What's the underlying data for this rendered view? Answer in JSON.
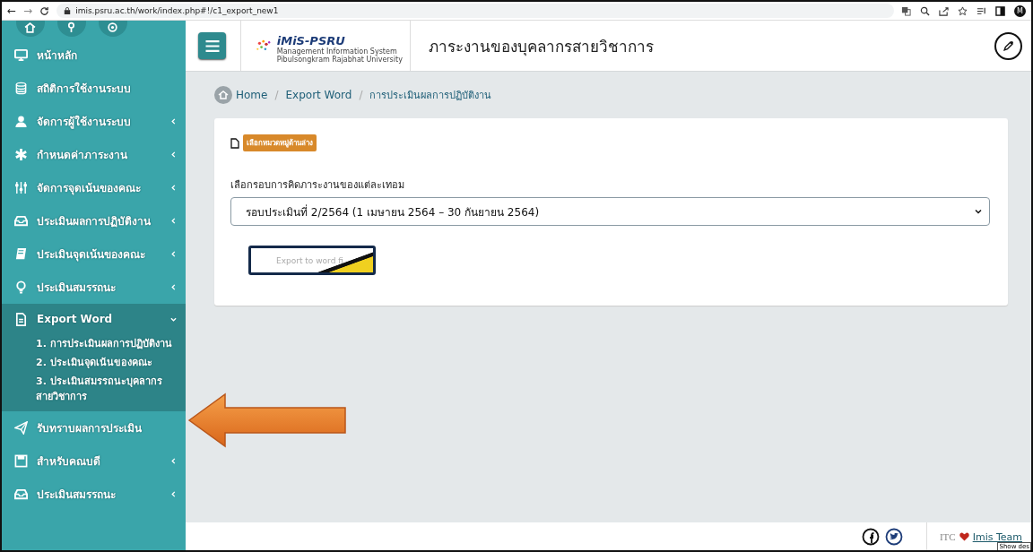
{
  "browser": {
    "back": "←",
    "forward": "→",
    "url": "imis.psru.ac.th/work/index.php#!/c1_export_new1",
    "profile": "M"
  },
  "sidebar": {
    "items": [
      {
        "label": "หน้าหลัก",
        "kind": "monitor",
        "has_caret": false,
        "expanded": false
      },
      {
        "label": "สถิติการใช้งานระบบ",
        "kind": "database",
        "has_caret": false,
        "expanded": false
      },
      {
        "label": "จัดการผู้ใช้งานระบบ",
        "kind": "user",
        "has_caret": true,
        "expanded": false
      },
      {
        "label": "กำหนดค่าภาระงาน",
        "kind": "asterisk",
        "has_caret": true,
        "expanded": false
      },
      {
        "label": "จัดการจุดเน้นของคณะ",
        "kind": "sliders",
        "has_caret": true,
        "expanded": false
      },
      {
        "label": "ประเมินผลการปฏิบัติงาน",
        "kind": "inbox",
        "has_caret": true,
        "expanded": false
      },
      {
        "label": "ประเมินจุดเน้นของคณะ",
        "kind": "book",
        "has_caret": true,
        "expanded": false
      },
      {
        "label": "ประเมินสมรรถนะ",
        "kind": "bulb",
        "has_caret": true,
        "expanded": false
      },
      {
        "label": "Export Word",
        "kind": "file",
        "has_caret": true,
        "expanded": true,
        "children": [
          {
            "label": "1. การประเมินผลการปฏิบัติงาน"
          },
          {
            "label": "2. ประเมินจุดเน้นของคณะ"
          },
          {
            "label": "3. ประเมินสมรรถนะบุคลากรสายวิชาการ"
          }
        ]
      },
      {
        "label": "รับทราบผลการประเมิน",
        "kind": "plane",
        "has_caret": false,
        "expanded": false
      },
      {
        "label": "สำหรับคณบดี",
        "kind": "save",
        "has_caret": true,
        "expanded": false
      },
      {
        "label": "ประเมินสมรรถนะ",
        "kind": "inbox",
        "has_caret": true,
        "expanded": false
      }
    ]
  },
  "header": {
    "logo": "iMiS-PSRU",
    "logo_sub": "Management Information System Pibulsongkram Rajabhat University",
    "title": "ภาระงานของบุคลากรสายวิชาการ"
  },
  "breadcrumb_separator": "/",
  "breadcrumb": [
    "Home",
    "Export Word",
    "การประเมินผลการปฏิบัติงาน"
  ],
  "card": {
    "badge": "เลือกหมวดหมู่ด้านล่าง",
    "select_label": "เลือกรอบการคิดภาระงานของแต่ละเทอม",
    "select_value": "รอบประเมินที่ 2/2564 (1 เมษายน 2564 – 30 กันยายน 2564)",
    "export_button": "Export to word fi"
  },
  "footer": {
    "credit_left": "ITC",
    "credit_right": "Imis Team",
    "tooltip": "Show des"
  }
}
